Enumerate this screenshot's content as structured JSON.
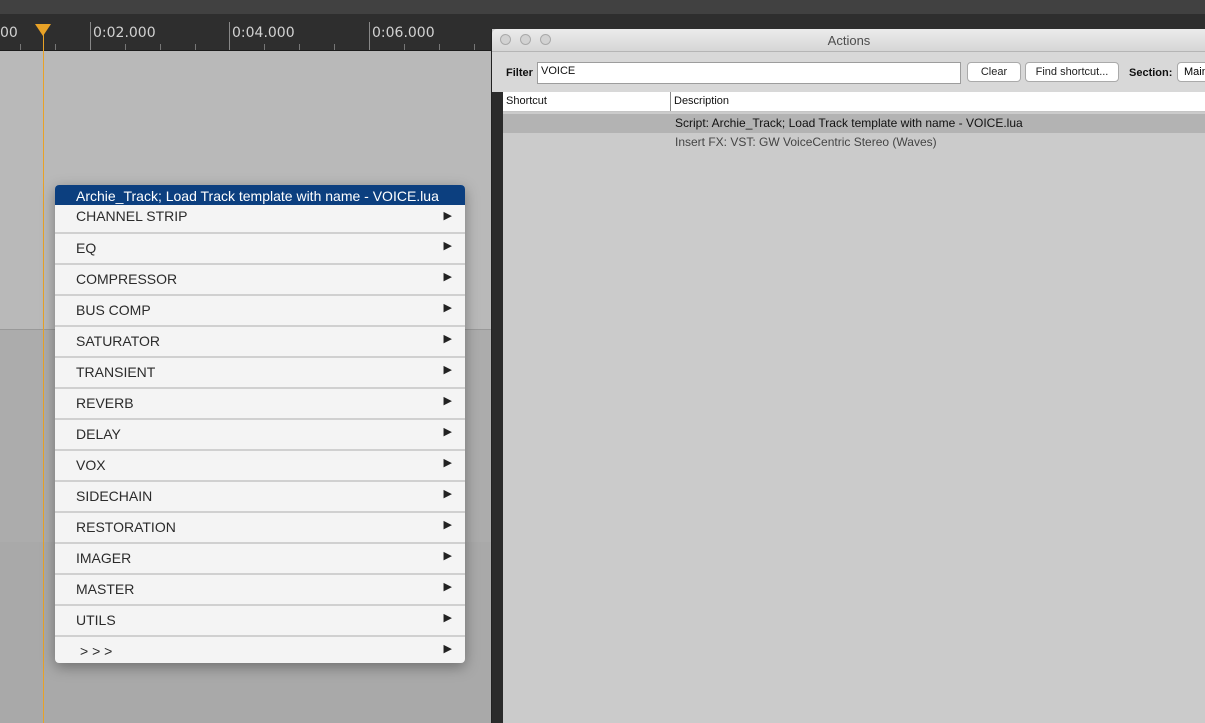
{
  "ruler": {
    "labels": [
      "00",
      "0:02.000",
      "0:04.000",
      "0:06.000"
    ]
  },
  "context_menu": {
    "header": "Archie_Track; Load Track template with name - VOICE.lua",
    "items": [
      {
        "label": "CHANNEL STRIP"
      },
      {
        "label": "EQ"
      },
      {
        "label": "COMPRESSOR"
      },
      {
        "label": "BUS COMP"
      },
      {
        "label": "SATURATOR"
      },
      {
        "label": "TRANSIENT"
      },
      {
        "label": "REVERB"
      },
      {
        "label": "DELAY"
      },
      {
        "label": "VOX"
      },
      {
        "label": "SIDECHAIN"
      },
      {
        "label": "RESTORATION"
      },
      {
        "label": "IMAGER"
      },
      {
        "label": "MASTER"
      },
      {
        "label": "UTILS"
      },
      {
        "label": "> > >"
      }
    ],
    "submenu_arrow": "▶"
  },
  "actions_window": {
    "title": "Actions",
    "filter_label": "Filter",
    "filter_value": "VOICE",
    "clear_label": "Clear",
    "find_shortcut_label": "Find shortcut...",
    "section_label": "Section:",
    "section_value": "Main",
    "columns": {
      "shortcut": "Shortcut",
      "description": "Description"
    },
    "rows": [
      {
        "shortcut": "",
        "description": "Script: Archie_Track; Load Track template with name - VOICE.lua",
        "selected": true
      },
      {
        "shortcut": "",
        "description": "Insert FX: VST: GW VoiceCentric Stereo (Waves)",
        "selected": false
      }
    ]
  },
  "colors": {
    "playhead": "#e8a227",
    "menu_highlight": "#0c3f7f"
  }
}
